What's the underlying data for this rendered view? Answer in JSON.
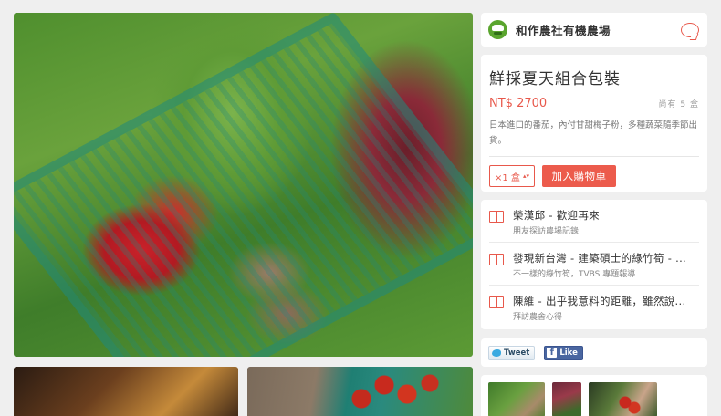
{
  "farm": {
    "name": "和作農社有機農場"
  },
  "product": {
    "title": "鮮採夏天組合包裝",
    "price": "NT$ 2700",
    "stock": "尚有 5 盒",
    "description": "日本進口的番茄，內付甘甜梅子粉，多種蔬菜隨季節出貨。",
    "quantity": "×1 盒",
    "add_to_cart_label": "加入購物車"
  },
  "articles": [
    {
      "title": "榮漢邱 - 歡迎再來",
      "subtitle": "朋友探訪農場記錄"
    },
    {
      "title": "發現新台灣 - 建築碩士的綠竹筍 - ...",
      "subtitle": "不一樣的綠竹筍，TVBS 專題報導"
    },
    {
      "title": "陳維 - 出乎我意料的距離，雖然說...",
      "subtitle": "拜訪農舍心得"
    }
  ],
  "social": {
    "tweet_label": "Tweet",
    "like_label": "Like"
  },
  "icons": [
    "farm-logo-icon",
    "chat-icon",
    "book-icon",
    "twitter-bird-icon",
    "facebook-icon"
  ],
  "colors": {
    "accent": "#e8584b",
    "background": "#efefef",
    "card": "#ffffff"
  }
}
